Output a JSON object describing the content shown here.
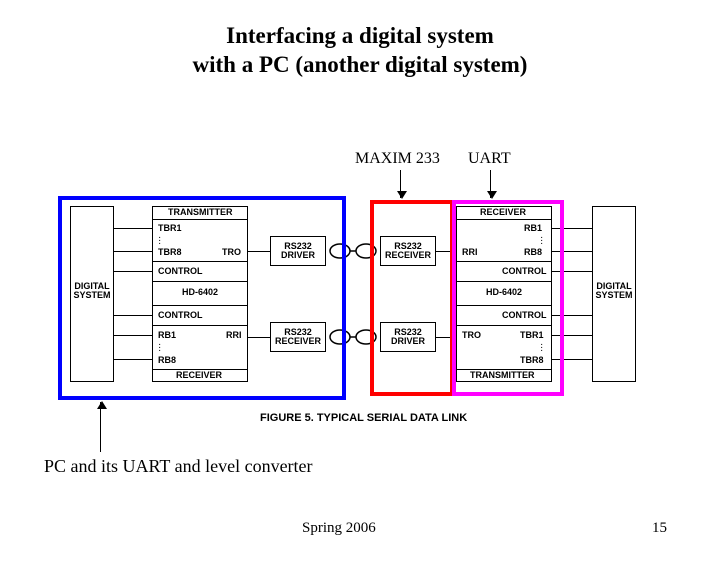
{
  "title_line1": "Interfacing a digital system",
  "title_line2": "with a PC (another digital system)",
  "top_labels": {
    "maxim": "MAXIM 233",
    "uart": "UART"
  },
  "left_sys": "DIGITAL\nSYSTEM",
  "right_sys": "DIGITAL\nSYSTEM",
  "left_uart": {
    "tx": "TRANSMITTER",
    "tbr1": "TBR1",
    "tbr8": "TBR8",
    "tro": "TRO",
    "ctrl_top": "CONTROL",
    "chip": "HD-6402",
    "ctrl_bot": "CONTROL",
    "rb1": "RB1",
    "rb8": "RB8",
    "rri": "RRI",
    "rx": "RECEIVER"
  },
  "right_uart": {
    "rx": "RECEIVER",
    "rb1": "RB1",
    "rb8": "RB8",
    "rri": "RRI",
    "ctrl_top": "CONTROL",
    "chip": "HD-6402",
    "ctrl_bot": "CONTROL",
    "tbr1": "TBR1",
    "tbr8": "TBR8",
    "tro": "TRO",
    "tx": "TRANSMITTER"
  },
  "drv": {
    "rs_drv": "RS232\nDRIVER",
    "rs_rcv": "RS232\nRECEIVER"
  },
  "fig_caption": "FIGURE 5.  TYPICAL SERIAL DATA LINK",
  "bottom_note": "PC and its UART and level converter",
  "footer_center": "Spring 2006",
  "footer_right": "15",
  "chart_data": {
    "type": "diagram",
    "title": "Interfacing a digital system with a PC (another digital system)",
    "nodes": [
      {
        "id": "dsL",
        "label": "DIGITAL SYSTEM (left)"
      },
      {
        "id": "uartL",
        "label": "HD-6402 UART (left) — TRANSMITTER/RECEIVER, TBR1..TBR8, RB1..RB8, TRO, RRI, CONTROL"
      },
      {
        "id": "drvL",
        "label": "RS232 DRIVER (left)"
      },
      {
        "id": "rcvL",
        "label": "RS232 RECEIVER (left)"
      },
      {
        "id": "rcvR",
        "label": "RS232 RECEIVER (right)"
      },
      {
        "id": "drvR",
        "label": "RS232 DRIVER (right)"
      },
      {
        "id": "uartR",
        "label": "HD-6402 UART (right) — RECEIVER/TRANSMITTER, RB1..RB8, TBR1..TBR8, RRI, TRO, CONTROL"
      },
      {
        "id": "dsR",
        "label": "DIGITAL SYSTEM (right)"
      }
    ],
    "edges": [
      {
        "from": "dsL",
        "to": "uartL",
        "label": "parallel TBR1..TBR8 / RB1..RB8 + CONTROL"
      },
      {
        "from": "uartL",
        "to": "drvL",
        "label": "TRO (serial out)"
      },
      {
        "from": "drvL",
        "to": "rcvR",
        "label": "RS232 line (twisted pair)"
      },
      {
        "from": "rcvR",
        "to": "uartR",
        "label": "RRI (serial in)"
      },
      {
        "from": "uartR",
        "to": "dsR",
        "label": "parallel RB1..RB8 / TBR1..TBR8 + CONTROL"
      },
      {
        "from": "dsR",
        "to": "uartR",
        "label": "parallel"
      },
      {
        "from": "uartR",
        "to": "drvR",
        "label": "TRO (serial out)"
      },
      {
        "from": "drvR",
        "to": "rcvL",
        "label": "RS232 line (twisted pair)"
      },
      {
        "from": "rcvL",
        "to": "uartL",
        "label": "RRI (serial in)"
      }
    ],
    "annotations": [
      {
        "target": [
          "rcvR",
          "drvR"
        ],
        "text": "MAXIM 233",
        "highlight": "red"
      },
      {
        "target": "uartR",
        "text": "UART",
        "highlight": "magenta"
      },
      {
        "target": [
          "dsL",
          "uartL",
          "drvL",
          "rcvL"
        ],
        "text": "PC and its UART and level converter",
        "highlight": "blue"
      }
    ],
    "caption": "FIGURE 5.  TYPICAL SERIAL DATA LINK"
  }
}
